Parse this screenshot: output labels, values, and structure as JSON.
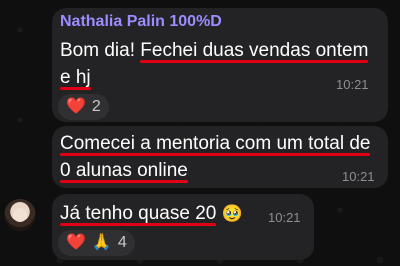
{
  "chat": {
    "msg1": {
      "sender": "Nathalia Palin 100%D",
      "text_plain": "Bom dia! ",
      "text_hl1": "Fechei duas vendas ontem",
      "text_hl2": "e hj",
      "time": "10:21",
      "reaction_emoji": "❤️",
      "reaction_count": "2"
    },
    "msg2": {
      "line1": "Comecei a mentoria com um total de",
      "line2": "0 alunas online",
      "time": "10:21"
    },
    "msg3": {
      "text_hl": "Já tenho quase 20",
      "emoji": "🥹",
      "time": "10:21",
      "reaction_heart": "❤️",
      "reaction_pray": "🙏",
      "reaction_count": "4"
    },
    "colors": {
      "sender": "#9b8cff",
      "underline": "#e10013",
      "bubble": "#232325",
      "background": "#0f0f10"
    }
  }
}
